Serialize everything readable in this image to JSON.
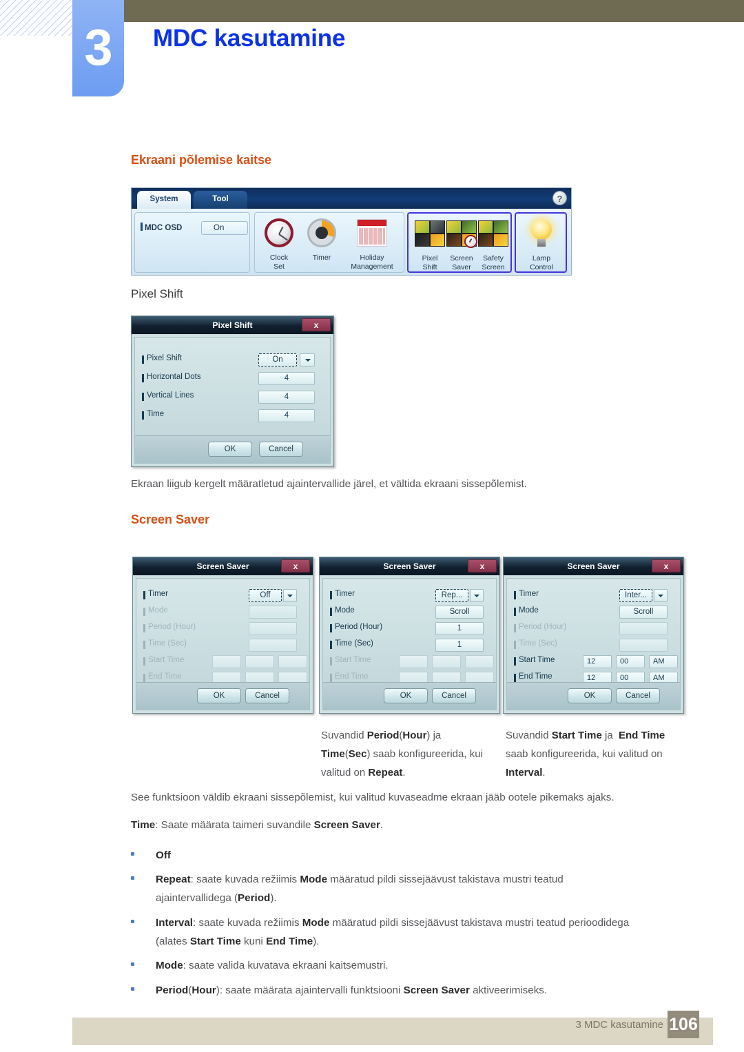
{
  "header": {
    "chapter_number": "3",
    "chapter_title": "MDC kasutamine"
  },
  "sections": {
    "burn_protection_heading": "Ekraani põlemise kaitse",
    "pixel_shift_subheading": "Pixel Shift",
    "pixel_shift_desc": "Ekraan liigub kergelt määratletud ajaintervallide järel, et vältida ekraani sissepõlemist.",
    "screen_saver_heading": "Screen Saver"
  },
  "mdc_toolbar": {
    "tabs": [
      {
        "label": "System",
        "active": true
      },
      {
        "label": "Tool",
        "active": false
      }
    ],
    "help_icon": "?",
    "osd": {
      "label": "MDC OSD",
      "value": "On"
    },
    "tools": [
      {
        "name": "clock-set-icon",
        "line1": "Clock",
        "line2": "Set"
      },
      {
        "name": "timer-icon",
        "line1": "Timer",
        "line2": ""
      },
      {
        "name": "holiday-management-icon",
        "line1": "Holiday",
        "line2": "Management"
      },
      {
        "name": "pixel-shift-icon",
        "line1": "Pixel",
        "line2": "Shift"
      },
      {
        "name": "screen-saver-icon",
        "line1": "Screen",
        "line2": "Saver"
      },
      {
        "name": "safety-screen-icon",
        "line1": "Safety",
        "line2": "Screen"
      },
      {
        "name": "lamp-control-icon",
        "line1": "Lamp",
        "line2": "Control"
      }
    ]
  },
  "pixel_shift_dialog": {
    "title": "Pixel Shift",
    "close_label": "x",
    "rows": [
      {
        "label": "Pixel Shift",
        "value": "On"
      },
      {
        "label": "Horizontal Dots",
        "value": "4"
      },
      {
        "label": "Vertical Lines",
        "value": "4"
      },
      {
        "label": "Time",
        "value": "4"
      }
    ],
    "ok": "OK",
    "cancel": "Cancel"
  },
  "screen_saver_dialogs": [
    {
      "title": "Screen Saver",
      "close_label": "x",
      "timer": "Off",
      "mode": "",
      "period": "",
      "time_sec": "",
      "start_time": [
        "",
        "",
        ""
      ],
      "end_time": [
        "",
        "",
        ""
      ],
      "ok": "OK",
      "cancel": "Cancel"
    },
    {
      "title": "Screen Saver",
      "close_label": "x",
      "timer": "Rep...",
      "mode": "Scroll",
      "period": "1",
      "time_sec": "1",
      "start_time": [
        "",
        "",
        ""
      ],
      "end_time": [
        "",
        "",
        ""
      ],
      "ok": "OK",
      "cancel": "Cancel"
    },
    {
      "title": "Screen Saver",
      "close_label": "x",
      "timer": "Inter...",
      "mode": "Scroll",
      "period": "",
      "time_sec": "",
      "start_time": [
        "12",
        "00",
        "AM"
      ],
      "end_time": [
        "12",
        "00",
        "AM"
      ],
      "ok": "OK",
      "cancel": "Cancel"
    }
  ],
  "dialog_row_labels": {
    "timer": "Timer",
    "mode": "Mode",
    "period": "Period (Hour)",
    "time_sec": "Time (Sec)",
    "start_time": "Start Time",
    "end_time": "End Time"
  },
  "captions": {
    "left_html": "Suvandid <b>Period</b>(<b>Hour</b>) ja <b>Time</b>(<b>Sec</b>) saab konfigureerida, kui valitud on <b>Repeat</b>.",
    "right_html": "Suvandid <b>Start Time</b> ja&nbsp; <b>End Time</b>&nbsp; saab konfigureerida, kui valitud on <b>Interval</b>."
  },
  "body": {
    "intro_html": "See funktsioon väldib ekraani sissepõlemist, kui valitud kuvaseadme ekraan jääb ootele pikemaks ajaks.",
    "time_line_html": "<b>Time</b>: Saate määrata taimeri suvandile <b>Screen Saver</b>.",
    "bullets_html": [
      "<b>Off</b>",
      "<b>Repeat</b>: saate kuvada režiimis <b>Mode</b> määratud pildi sissejäävust takistava mustri teatud ajaintervallidega (<b>Period</b>).",
      "<b>Interval</b>: saate kuvada režiimis <b>Mode</b> määratud pildi sissejäävust takistava mustri teatud perioodidega (alates <b>Start Time</b> kuni <b>End Time</b>).",
      "<b>Mode</b>: saate valida kuvatava ekraani kaitsemustri.",
      "<b>Period</b>(<b>Hour</b>): saate määrata ajaintervalli funktsiooni <b>Screen Saver</b> aktiveerimiseks."
    ]
  },
  "footer": {
    "text": "3 MDC kasutamine",
    "page_number": "106"
  },
  "colors": {
    "chapter_title": "#0b33e8",
    "section_heading": "#d94f14",
    "header_bar": "#6f6a52",
    "chapter_tab": "#6d9cf2",
    "footer_bar": "#dcd6c4",
    "footer_number_bg": "#938b7c",
    "bullet": "#4a79d4",
    "highlight_border": "#4433dd"
  }
}
